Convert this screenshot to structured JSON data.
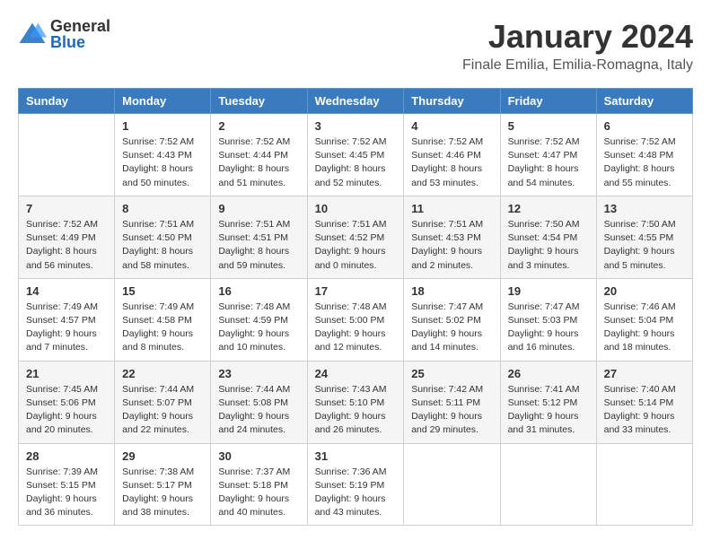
{
  "logo": {
    "general": "General",
    "blue": "Blue"
  },
  "title": "January 2024",
  "location": "Finale Emilia, Emilia-Romagna, Italy",
  "days_of_week": [
    "Sunday",
    "Monday",
    "Tuesday",
    "Wednesday",
    "Thursday",
    "Friday",
    "Saturday"
  ],
  "weeks": [
    [
      {
        "day": "",
        "info": ""
      },
      {
        "day": "1",
        "info": "Sunrise: 7:52 AM\nSunset: 4:43 PM\nDaylight: 8 hours\nand 50 minutes."
      },
      {
        "day": "2",
        "info": "Sunrise: 7:52 AM\nSunset: 4:44 PM\nDaylight: 8 hours\nand 51 minutes."
      },
      {
        "day": "3",
        "info": "Sunrise: 7:52 AM\nSunset: 4:45 PM\nDaylight: 8 hours\nand 52 minutes."
      },
      {
        "day": "4",
        "info": "Sunrise: 7:52 AM\nSunset: 4:46 PM\nDaylight: 8 hours\nand 53 minutes."
      },
      {
        "day": "5",
        "info": "Sunrise: 7:52 AM\nSunset: 4:47 PM\nDaylight: 8 hours\nand 54 minutes."
      },
      {
        "day": "6",
        "info": "Sunrise: 7:52 AM\nSunset: 4:48 PM\nDaylight: 8 hours\nand 55 minutes."
      }
    ],
    [
      {
        "day": "7",
        "info": "Sunrise: 7:52 AM\nSunset: 4:49 PM\nDaylight: 8 hours\nand 56 minutes."
      },
      {
        "day": "8",
        "info": "Sunrise: 7:51 AM\nSunset: 4:50 PM\nDaylight: 8 hours\nand 58 minutes."
      },
      {
        "day": "9",
        "info": "Sunrise: 7:51 AM\nSunset: 4:51 PM\nDaylight: 8 hours\nand 59 minutes."
      },
      {
        "day": "10",
        "info": "Sunrise: 7:51 AM\nSunset: 4:52 PM\nDaylight: 9 hours\nand 0 minutes."
      },
      {
        "day": "11",
        "info": "Sunrise: 7:51 AM\nSunset: 4:53 PM\nDaylight: 9 hours\nand 2 minutes."
      },
      {
        "day": "12",
        "info": "Sunrise: 7:50 AM\nSunset: 4:54 PM\nDaylight: 9 hours\nand 3 minutes."
      },
      {
        "day": "13",
        "info": "Sunrise: 7:50 AM\nSunset: 4:55 PM\nDaylight: 9 hours\nand 5 minutes."
      }
    ],
    [
      {
        "day": "14",
        "info": "Sunrise: 7:49 AM\nSunset: 4:57 PM\nDaylight: 9 hours\nand 7 minutes."
      },
      {
        "day": "15",
        "info": "Sunrise: 7:49 AM\nSunset: 4:58 PM\nDaylight: 9 hours\nand 8 minutes."
      },
      {
        "day": "16",
        "info": "Sunrise: 7:48 AM\nSunset: 4:59 PM\nDaylight: 9 hours\nand 10 minutes."
      },
      {
        "day": "17",
        "info": "Sunrise: 7:48 AM\nSunset: 5:00 PM\nDaylight: 9 hours\nand 12 minutes."
      },
      {
        "day": "18",
        "info": "Sunrise: 7:47 AM\nSunset: 5:02 PM\nDaylight: 9 hours\nand 14 minutes."
      },
      {
        "day": "19",
        "info": "Sunrise: 7:47 AM\nSunset: 5:03 PM\nDaylight: 9 hours\nand 16 minutes."
      },
      {
        "day": "20",
        "info": "Sunrise: 7:46 AM\nSunset: 5:04 PM\nDaylight: 9 hours\nand 18 minutes."
      }
    ],
    [
      {
        "day": "21",
        "info": "Sunrise: 7:45 AM\nSunset: 5:06 PM\nDaylight: 9 hours\nand 20 minutes."
      },
      {
        "day": "22",
        "info": "Sunrise: 7:44 AM\nSunset: 5:07 PM\nDaylight: 9 hours\nand 22 minutes."
      },
      {
        "day": "23",
        "info": "Sunrise: 7:44 AM\nSunset: 5:08 PM\nDaylight: 9 hours\nand 24 minutes."
      },
      {
        "day": "24",
        "info": "Sunrise: 7:43 AM\nSunset: 5:10 PM\nDaylight: 9 hours\nand 26 minutes."
      },
      {
        "day": "25",
        "info": "Sunrise: 7:42 AM\nSunset: 5:11 PM\nDaylight: 9 hours\nand 29 minutes."
      },
      {
        "day": "26",
        "info": "Sunrise: 7:41 AM\nSunset: 5:12 PM\nDaylight: 9 hours\nand 31 minutes."
      },
      {
        "day": "27",
        "info": "Sunrise: 7:40 AM\nSunset: 5:14 PM\nDaylight: 9 hours\nand 33 minutes."
      }
    ],
    [
      {
        "day": "28",
        "info": "Sunrise: 7:39 AM\nSunset: 5:15 PM\nDaylight: 9 hours\nand 36 minutes."
      },
      {
        "day": "29",
        "info": "Sunrise: 7:38 AM\nSunset: 5:17 PM\nDaylight: 9 hours\nand 38 minutes."
      },
      {
        "day": "30",
        "info": "Sunrise: 7:37 AM\nSunset: 5:18 PM\nDaylight: 9 hours\nand 40 minutes."
      },
      {
        "day": "31",
        "info": "Sunrise: 7:36 AM\nSunset: 5:19 PM\nDaylight: 9 hours\nand 43 minutes."
      },
      {
        "day": "",
        "info": ""
      },
      {
        "day": "",
        "info": ""
      },
      {
        "day": "",
        "info": ""
      }
    ]
  ]
}
